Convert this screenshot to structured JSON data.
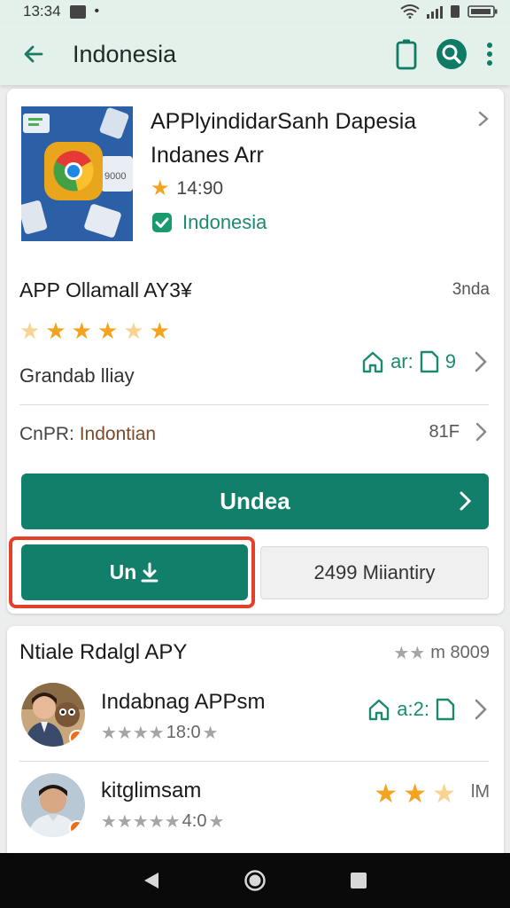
{
  "status_bar": {
    "time": "13:34",
    "battery": ""
  },
  "app_bar": {
    "title": "Indonesia"
  },
  "app": {
    "name_line1": "APPlyindidarSanh Dapesia",
    "name_line2": "Indanes Arr",
    "rating_value": "14:90",
    "country": "Indonesia"
  },
  "section": {
    "title": "APP Ollamall AY3¥",
    "right_text": "3nda",
    "rating_stars": 4.5,
    "grand_label": "Grandab lliay",
    "grand_right": "ar:",
    "grand_right_num": "9",
    "cnpr_prefix": "CnPR:",
    "cnpr_value": "Indontian",
    "cnpr_right": "81F"
  },
  "buttons": {
    "main_label": "Undea",
    "install_label": "Un",
    "secondary_label": "2499 Miiantiry"
  },
  "related": {
    "title": "Ntiale Rdalgl APY",
    "right_text": "m 8009",
    "items": [
      {
        "name": "Indabnag APPsm",
        "stars_text": "18:0",
        "right_text": "a:2:"
      },
      {
        "name": "kitglimsam",
        "stars_text": "4:0",
        "right_text": "lM"
      }
    ]
  },
  "colors": {
    "accent": "#127f6b",
    "highlight": "#e5412a",
    "star": "#f4a321",
    "link_green": "#1b8a6e"
  },
  "icons": [
    "back-arrow-icon",
    "phone-icon",
    "search-icon",
    "more-vert-icon",
    "chevron-right-icon",
    "verified-icon",
    "home-icon",
    "sim-icon",
    "download-icon",
    "star-icon",
    "play-badge-icon",
    "back-nav-icon",
    "home-nav-icon",
    "recents-nav-icon"
  ]
}
